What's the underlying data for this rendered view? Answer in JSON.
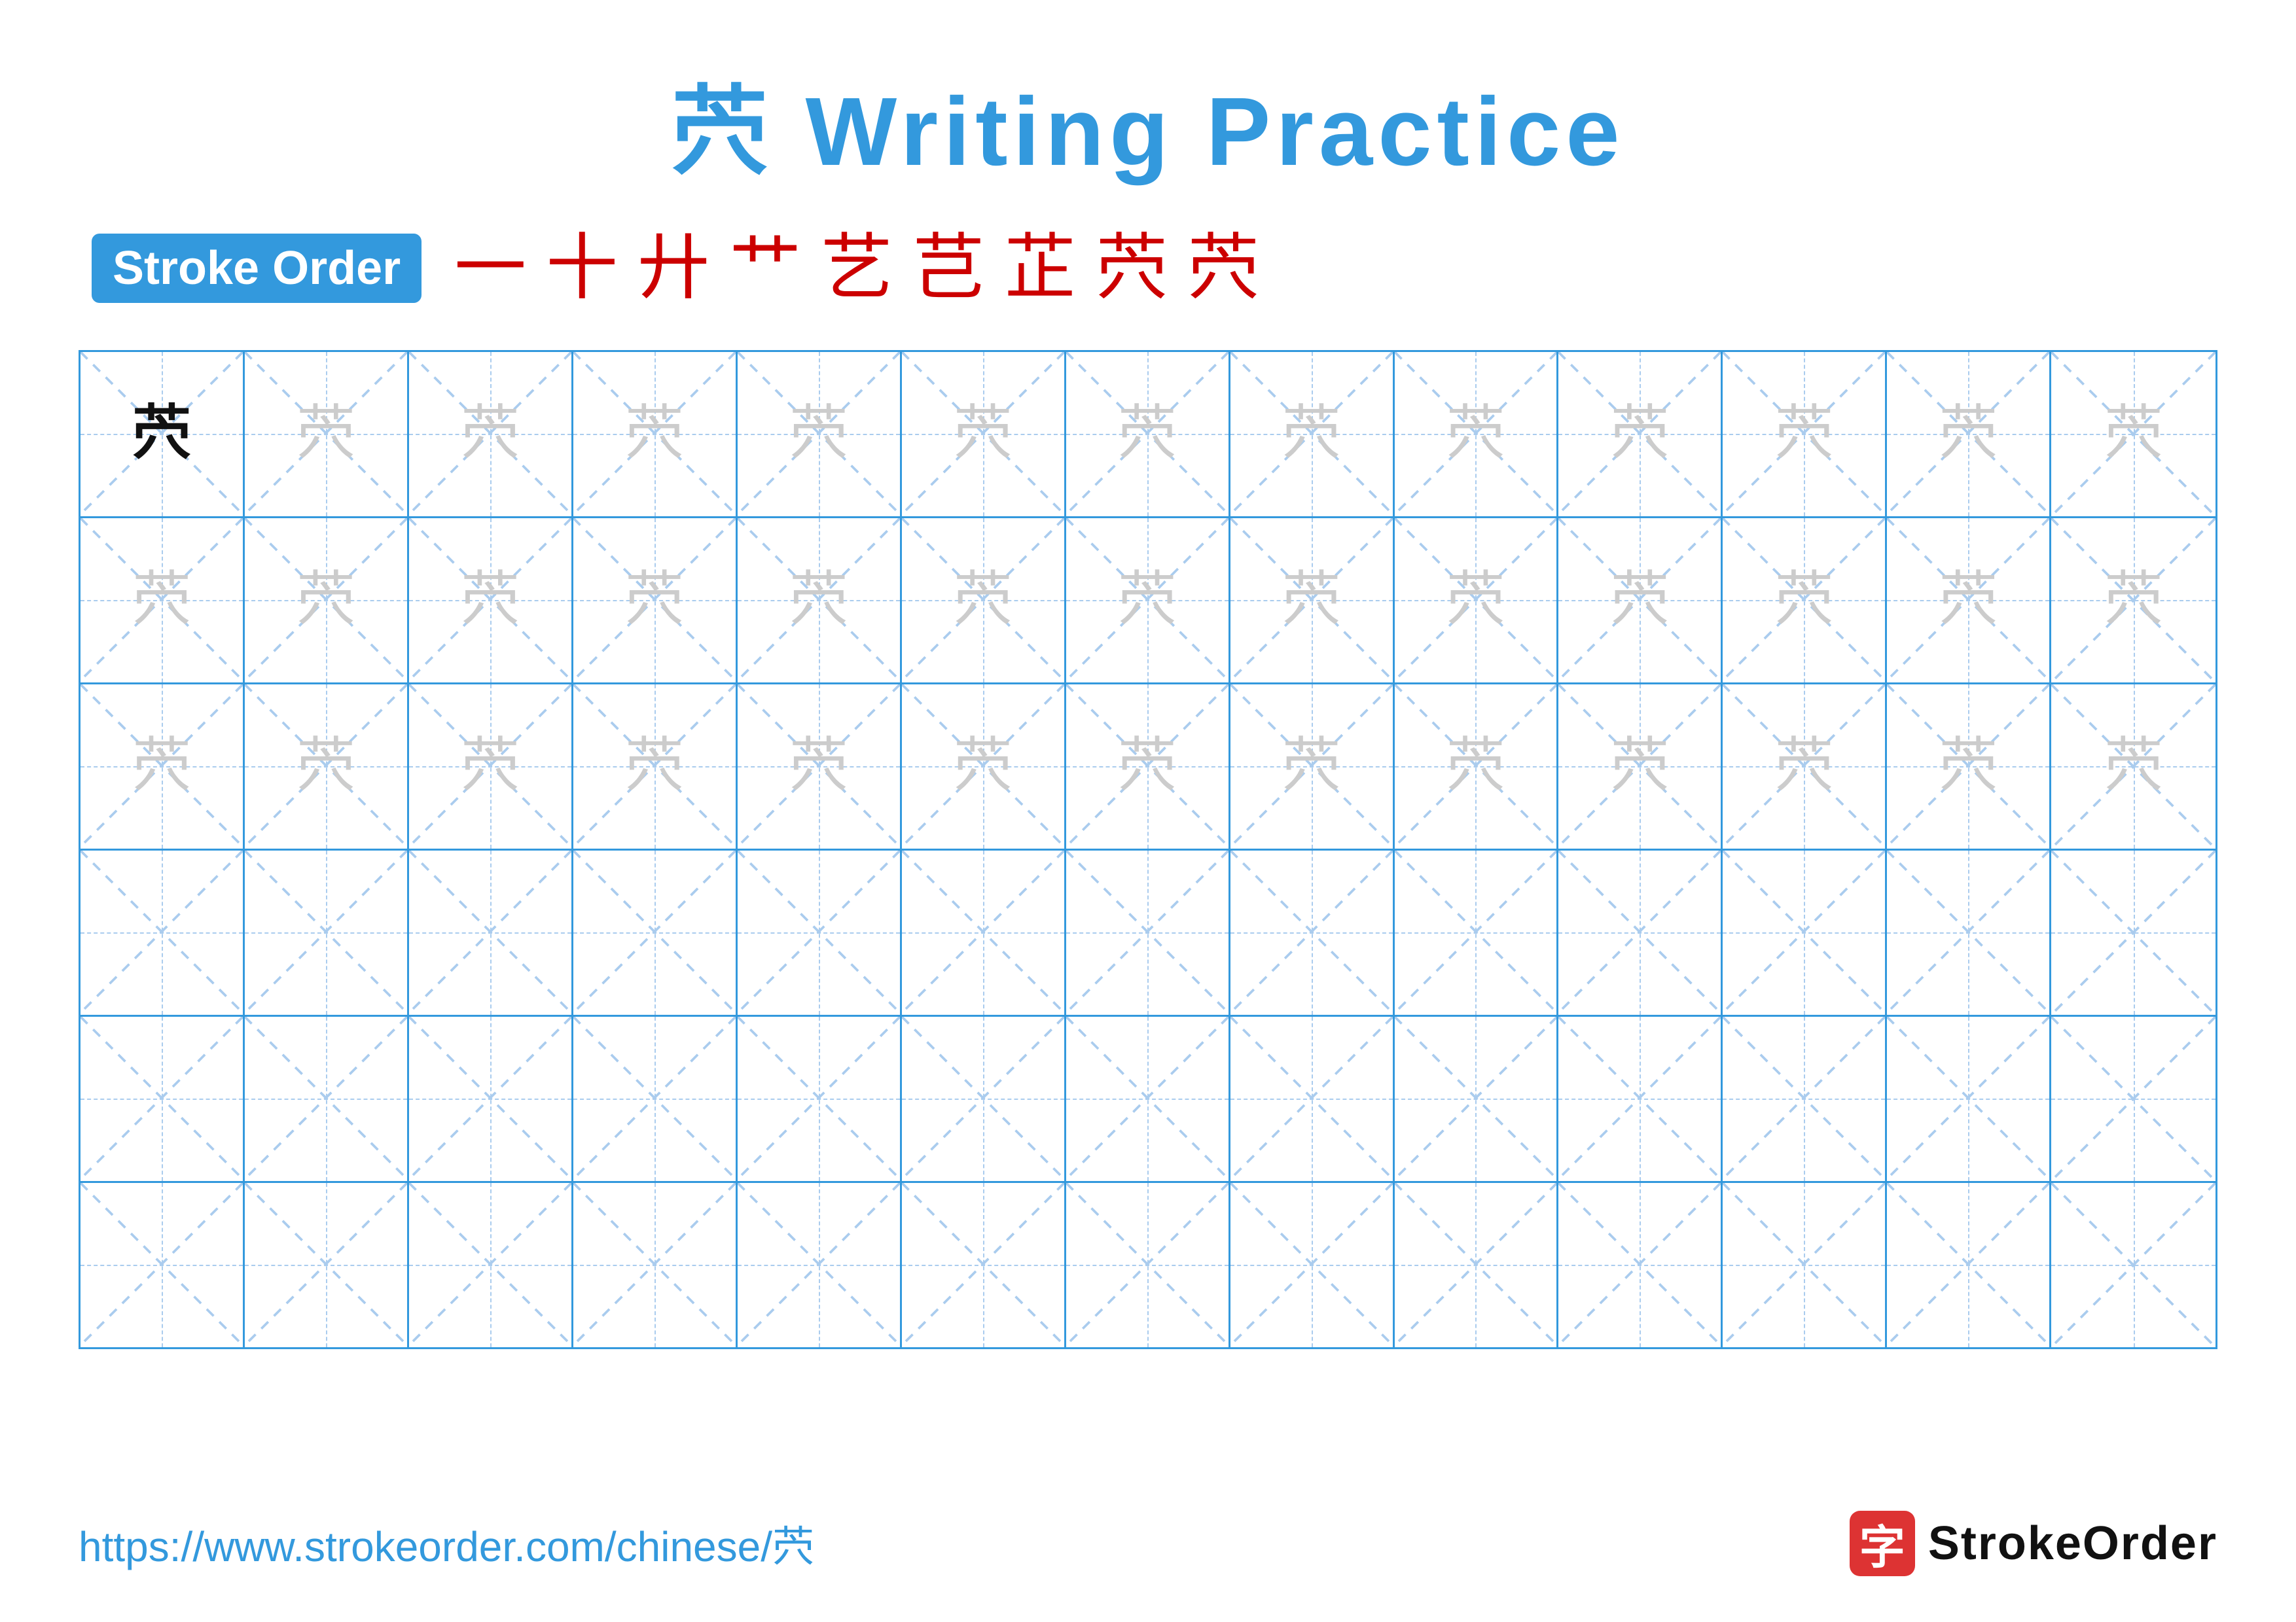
{
  "title": {
    "char": "茓",
    "text": " Writing Practice"
  },
  "stroke_order": {
    "badge_label": "Stroke Order",
    "strokes": [
      "一",
      "十",
      "廾",
      "艹",
      "艺",
      "芑",
      "芷",
      "茓",
      "茓"
    ]
  },
  "grid": {
    "rows": 6,
    "cols": 13,
    "practice_char": "茓",
    "filled_rows": [
      {
        "row": 0,
        "cells": [
          {
            "type": "dark"
          },
          {
            "type": "light"
          },
          {
            "type": "light"
          },
          {
            "type": "light"
          },
          {
            "type": "light"
          },
          {
            "type": "light"
          },
          {
            "type": "light"
          },
          {
            "type": "light"
          },
          {
            "type": "light"
          },
          {
            "type": "light"
          },
          {
            "type": "light"
          },
          {
            "type": "light"
          },
          {
            "type": "light"
          }
        ]
      },
      {
        "row": 1,
        "cells": [
          {
            "type": "light"
          },
          {
            "type": "light"
          },
          {
            "type": "light"
          },
          {
            "type": "light"
          },
          {
            "type": "light"
          },
          {
            "type": "light"
          },
          {
            "type": "light"
          },
          {
            "type": "light"
          },
          {
            "type": "light"
          },
          {
            "type": "light"
          },
          {
            "type": "light"
          },
          {
            "type": "light"
          },
          {
            "type": "light"
          }
        ]
      },
      {
        "row": 2,
        "cells": [
          {
            "type": "light"
          },
          {
            "type": "light"
          },
          {
            "type": "light"
          },
          {
            "type": "light"
          },
          {
            "type": "light"
          },
          {
            "type": "light"
          },
          {
            "type": "light"
          },
          {
            "type": "light"
          },
          {
            "type": "light"
          },
          {
            "type": "light"
          },
          {
            "type": "light"
          },
          {
            "type": "light"
          },
          {
            "type": "light"
          }
        ]
      },
      {
        "row": 3,
        "cells": [
          {
            "type": "empty"
          },
          {
            "type": "empty"
          },
          {
            "type": "empty"
          },
          {
            "type": "empty"
          },
          {
            "type": "empty"
          },
          {
            "type": "empty"
          },
          {
            "type": "empty"
          },
          {
            "type": "empty"
          },
          {
            "type": "empty"
          },
          {
            "type": "empty"
          },
          {
            "type": "empty"
          },
          {
            "type": "empty"
          },
          {
            "type": "empty"
          }
        ]
      },
      {
        "row": 4,
        "cells": [
          {
            "type": "empty"
          },
          {
            "type": "empty"
          },
          {
            "type": "empty"
          },
          {
            "type": "empty"
          },
          {
            "type": "empty"
          },
          {
            "type": "empty"
          },
          {
            "type": "empty"
          },
          {
            "type": "empty"
          },
          {
            "type": "empty"
          },
          {
            "type": "empty"
          },
          {
            "type": "empty"
          },
          {
            "type": "empty"
          },
          {
            "type": "empty"
          }
        ]
      },
      {
        "row": 5,
        "cells": [
          {
            "type": "empty"
          },
          {
            "type": "empty"
          },
          {
            "type": "empty"
          },
          {
            "type": "empty"
          },
          {
            "type": "empty"
          },
          {
            "type": "empty"
          },
          {
            "type": "empty"
          },
          {
            "type": "empty"
          },
          {
            "type": "empty"
          },
          {
            "type": "empty"
          },
          {
            "type": "empty"
          },
          {
            "type": "empty"
          },
          {
            "type": "empty"
          }
        ]
      }
    ]
  },
  "footer": {
    "url": "https://www.strokeorder.com/chinese/茓",
    "logo_char": "字",
    "logo_text": "StrokeOrder"
  }
}
